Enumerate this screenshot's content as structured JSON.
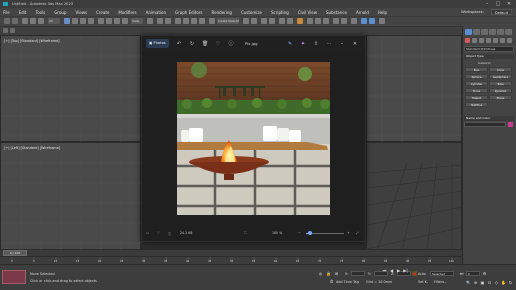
{
  "window": {
    "title": "Untitled - Autodesk 3ds Max 2023",
    "controls": [
      "–",
      "□",
      "✕"
    ]
  },
  "menubar": {
    "items": [
      "File",
      "Edit",
      "Tools",
      "Group",
      "Views",
      "Create",
      "Modifiers",
      "Animation",
      "Graph Editors",
      "Rendering",
      "Customize",
      "Scripting",
      "Civil View",
      "Substance",
      "Arnold",
      "Help"
    ],
    "workspace_label": "Workspaces:",
    "workspace_value": "Default"
  },
  "toolbar": {
    "view_dropdown": "View",
    "selection_set": "Create Selection Se"
  },
  "viewports": {
    "top_left_label": "[+] [Top] [Standard] [Wireframe]",
    "bottom_left_label": "[+] [Left] [Standard] [Wireframe]"
  },
  "command_panel": {
    "category": "Standard Primitives",
    "object_type_header": "Object Type",
    "autogrid": "AutoGrid",
    "buttons": [
      "Box",
      "Cone",
      "Sphere",
      "GeoSphere",
      "Cylinder",
      "Tube",
      "Torus",
      "Pyramid",
      "Teapot",
      "Plane",
      "TextPlus"
    ],
    "name_color_header": "Name and Color"
  },
  "photos": {
    "app_name": "Photos",
    "file_name": "Pix.jpg",
    "zoom": "100 %",
    "bottom_left_info": "24.1 KB"
  },
  "timeline": {
    "frame": "0 / 100",
    "ticks": [
      "0",
      "5",
      "10",
      "15",
      "20",
      "25",
      "30",
      "35",
      "40",
      "45",
      "50",
      "55",
      "60",
      "65",
      "70",
      "75",
      "80",
      "85",
      "90",
      "95",
      "100"
    ]
  },
  "status": {
    "selection": "None Selected",
    "prompt": "Click or click-and-drag to select objects",
    "x_label": "X:",
    "x_value": "",
    "y_label": "Y:",
    "y_value": "",
    "z_label": "Z:",
    "z_value": "",
    "grid": "Grid = 10.0mm",
    "add_time_tag": "Add Time Tag",
    "auto": "Auto",
    "selected": "Selected",
    "set_key": "Set K.",
    "filters": "Filters...",
    "frame_field": "0"
  },
  "colors": {
    "accent": "#1fa5b5",
    "toolbar_active": "#5b8fd1",
    "photos_bg": "#1f1f1f"
  }
}
